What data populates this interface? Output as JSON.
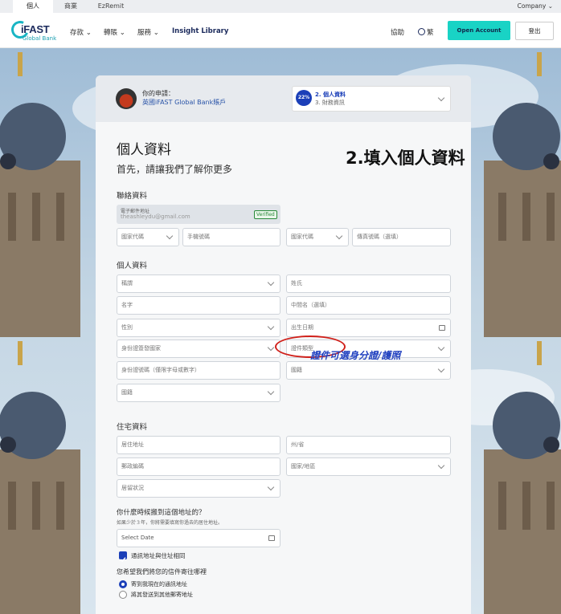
{
  "topbar": {
    "tabs": [
      "個人",
      "商業",
      "EzRemit"
    ],
    "company": "Company"
  },
  "nav": {
    "logo_main": "iFAST",
    "logo_sub": "Global Bank",
    "items": [
      "存款",
      "轉賬",
      "服務"
    ],
    "insight": "Insight Library",
    "help": "協助",
    "lang": "繁",
    "open_account": "Open Account",
    "logout": "登出"
  },
  "application": {
    "label": "你的申請：",
    "product": "英國iFAST Global Bank賬戶",
    "progress": "22%",
    "step_current": "2. 個人資料",
    "step_next": "3. 財務資訊"
  },
  "form": {
    "title": "個人資料",
    "subtitle": "首先，請讓我們了解你更多",
    "contact_section": "聯絡資料",
    "email_label": "電子郵件地址",
    "email_value": "theashleydu@gmail.com",
    "verified": "Verified",
    "country_code_1": "國家代碼",
    "mobile": "手機號碼",
    "country_code_2": "國家代碼",
    "fax": "傳真號碼（選填）",
    "personal_section": "個人資料",
    "salutation": "稱謂",
    "surname": "姓氏",
    "given_name": "名字",
    "middle_name": "中間名（選填）",
    "gender": "性別",
    "dob": "出生日期",
    "id_country": "身份證簽發國家",
    "id_type": "證件類型",
    "id_number": "身份證號碼（僅限字母或數字）",
    "nationality": "國籍",
    "nationality2": "國籍",
    "residence_section": "住宅資料",
    "address": "居住地址",
    "state": "州/省",
    "postcode": "郵政編碼",
    "country_region": "國家/地區",
    "residential_status": "居留狀況",
    "move_question": "你什麼時候搬到這個地址的？",
    "move_hint": "如果少於３年，你將需要填寫你過去的居住地址。",
    "select_date": "Select Date",
    "same_address": "通訊地址與住址相同",
    "mail_question": "您希望我們將您的信件寄往哪裡",
    "mail_opt1": "寄到我現在的通訊地址",
    "mail_opt2": "將其發送到其他郵寄地址"
  },
  "annotations": {
    "step_note": "2.填入個人資料",
    "id_note": "證件可選身分證/護照"
  }
}
